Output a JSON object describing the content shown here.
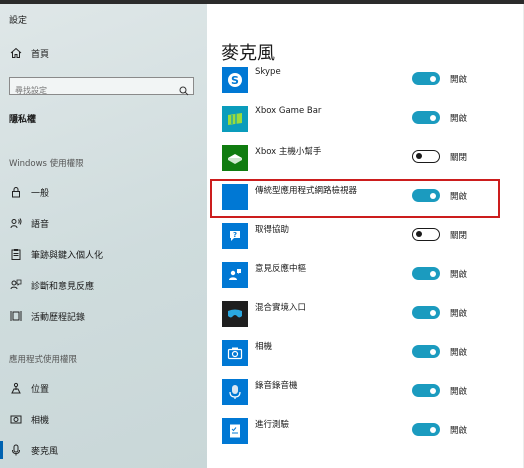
{
  "window": {
    "title": "設定"
  },
  "sidebar": {
    "home_label": "首頁",
    "search": {
      "placeholder": "尋找設定"
    },
    "section_privacy": "隱私權",
    "section_windows": "Windows 使用權限",
    "windows_items": [
      {
        "label": "一般",
        "icon": "lock-icon"
      },
      {
        "label": "語音",
        "icon": "speech-icon"
      },
      {
        "label": "筆跡與鍵入個人化",
        "icon": "clipboard-icon"
      },
      {
        "label": "診斷和意見反應",
        "icon": "feedback-icon"
      },
      {
        "label": "活動歷程記錄",
        "icon": "timeline-icon"
      }
    ],
    "section_apps": "應用程式使用權限",
    "apps_items": [
      {
        "label": "位置",
        "icon": "location-icon"
      },
      {
        "label": "相機",
        "icon": "camera-icon"
      },
      {
        "label": "麥克風",
        "icon": "microphone-icon"
      }
    ]
  },
  "main": {
    "title": "麥克風",
    "apps": [
      {
        "name": "Skype",
        "state": "開啟",
        "on": true,
        "color": "#0078d4"
      },
      {
        "name": "Xbox Game Bar",
        "state": "開啟",
        "on": true,
        "color": "#0a9cbc"
      },
      {
        "name": "Xbox 主機小幫手",
        "state": "關閉",
        "on": false,
        "color": "#107c10"
      },
      {
        "name": "傳統型應用程式網路檢視器",
        "state": "開啟",
        "on": true,
        "color": "#0078d4"
      },
      {
        "name": "取得協助",
        "state": "關閉",
        "on": false,
        "color": "#0078d4"
      },
      {
        "name": "意見反應中樞",
        "state": "開啟",
        "on": true,
        "color": "#0078d4"
      },
      {
        "name": "混合實境入口",
        "state": "開啟",
        "on": true,
        "color": "#1f1f1f"
      },
      {
        "name": "相機",
        "state": "開啟",
        "on": true,
        "color": "#0078d4"
      },
      {
        "name": "錄音錄音機",
        "state": "開啟",
        "on": true,
        "color": "#0078d4"
      },
      {
        "name": "進行測驗",
        "state": "開啟",
        "on": true,
        "color": "#0078d4"
      }
    ]
  },
  "colors": {
    "accent": "#1b9bbf",
    "highlight_border": "#cc1d1d",
    "active_indicator": "#0063b1"
  }
}
